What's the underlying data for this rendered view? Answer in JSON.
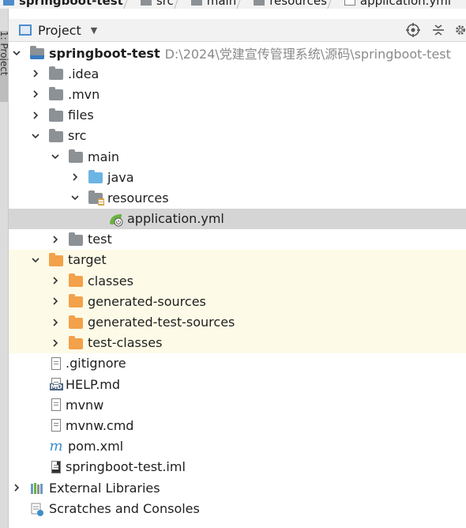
{
  "breadcrumb": {
    "items": [
      "springboot-test",
      "src",
      "main",
      "resources",
      "application.yml"
    ]
  },
  "tool_stripe": {
    "label": "1: Project"
  },
  "project_header": {
    "title": "Project",
    "icons": [
      "target-icon",
      "collapse-icon",
      "gear-icon"
    ]
  },
  "tree": {
    "root": {
      "name": "springboot-test",
      "path": "D:\\2024\\党建宣传管理系统\\源码\\springboot-test"
    },
    "idea": ".idea",
    "mvn": ".mvn",
    "files": "files",
    "src": "src",
    "main": "main",
    "java": "java",
    "resources": "resources",
    "application_yml": "application.yml",
    "test": "test",
    "target": "target",
    "classes": "classes",
    "generated_sources": "generated-sources",
    "generated_test_sources": "generated-test-sources",
    "test_classes": "test-classes",
    "gitignore": ".gitignore",
    "help_md": "HELP.md",
    "mvnw": "mvnw",
    "mvnw_cmd": "mvnw.cmd",
    "pom_xml": "pom.xml",
    "iml": "springboot-test.iml",
    "external_libraries": "External Libraries",
    "scratches": "Scratches and Consoles"
  },
  "colors": {
    "selected_row": "#d5d5d5",
    "excluded_bg": "#fdfbe7",
    "folder_gray": "#8c9196",
    "folder_blue": "#6cb4e4",
    "folder_orange": "#f3a14a",
    "path_gray": "#8a8a8a"
  }
}
